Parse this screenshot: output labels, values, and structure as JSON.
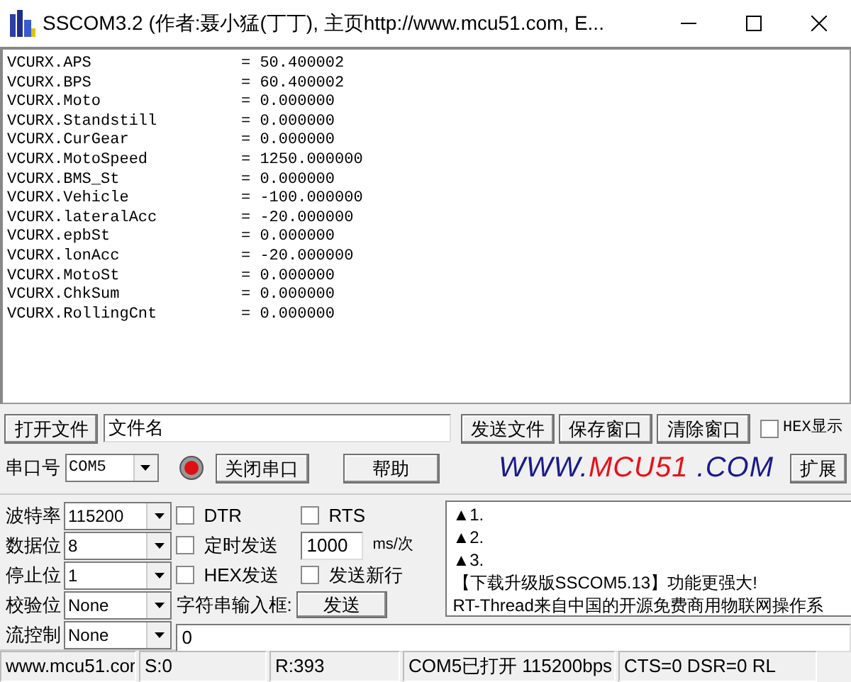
{
  "window": {
    "title": "SSCOM3.2 (作者:聂小猛(丁丁), 主页http://www.mcu51.com,  E..."
  },
  "receive_lines": [
    {
      "name": "VCURX.APS",
      "value": "= 50.400002"
    },
    {
      "name": "VCURX.BPS",
      "value": "= 60.400002"
    },
    {
      "name": "VCURX.Moto",
      "value": "= 0.000000"
    },
    {
      "name": "VCURX.Standstill",
      "value": "= 0.000000"
    },
    {
      "name": "VCURX.CurGear",
      "value": "= 0.000000"
    },
    {
      "name": "VCURX.MotoSpeed",
      "value": "= 1250.000000"
    },
    {
      "name": "VCURX.BMS_St",
      "value": "= 0.000000"
    },
    {
      "name": "VCURX.Vehicle",
      "value": "= -100.000000"
    },
    {
      "name": "VCURX.lateralAcc",
      "value": "= -20.000000"
    },
    {
      "name": "VCURX.epbSt",
      "value": "= 0.000000"
    },
    {
      "name": "VCURX.lonAcc",
      "value": "= -20.000000"
    },
    {
      "name": "VCURX.MotoSt",
      "value": "= 0.000000"
    },
    {
      "name": "VCURX.ChkSum",
      "value": "= 0.000000"
    },
    {
      "name": "VCURX.RollingCnt",
      "value": "= 0.000000"
    }
  ],
  "file_row": {
    "open_button": "打开文件",
    "file_field": "文件名",
    "buttons": [
      "发送文件",
      "保存窗口",
      "清除窗口"
    ],
    "hex_display": {
      "label": "HEX显示",
      "checked": false
    }
  },
  "port_row": {
    "port_label": "串口号",
    "port": "COM5",
    "lamp_on": true,
    "close_button": "关闭串口",
    "help_button": "帮助",
    "website": [
      {
        "text": "WWW.",
        "color": "#1a1a8c"
      },
      {
        "text": "MCU51",
        "color": "#e8101a"
      },
      {
        "text": " .COM",
        "color": "#1a1a8c"
      }
    ],
    "expand_button": "扩展"
  },
  "settings": [
    {
      "label": "波特率",
      "value": "115200"
    },
    {
      "label": "数据位",
      "value": "8"
    },
    {
      "label": "停止位",
      "value": "1"
    },
    {
      "label": "校验位",
      "value": "None"
    },
    {
      "label": "流控制",
      "value": "None"
    }
  ],
  "options": {
    "dtr": {
      "label": "DTR",
      "checked": false
    },
    "rts": {
      "label": "RTS",
      "checked": false
    },
    "timed_send": {
      "label": "定时发送",
      "checked": false
    },
    "interval": "1000",
    "interval_unit": "ms/次",
    "hex_send": {
      "label": "HEX发送",
      "checked": false
    },
    "send_newline": {
      "label": "发送新行",
      "checked": false
    },
    "input_label": "字符串输入框:",
    "send_button": "发送",
    "input_value": "0"
  },
  "notes": [
    "▲1.",
    "▲2.",
    "▲3.",
    "【下载升级版SSCOM5.13】功能更强大!",
    "RT-Thread来自中国的开源免费商用物联网操作系"
  ],
  "status_bar": [
    "www.mcu51.cor",
    "S:0",
    "R:393",
    "COM5已打开  115200bps",
    "CTS=0 DSR=0 RL"
  ]
}
